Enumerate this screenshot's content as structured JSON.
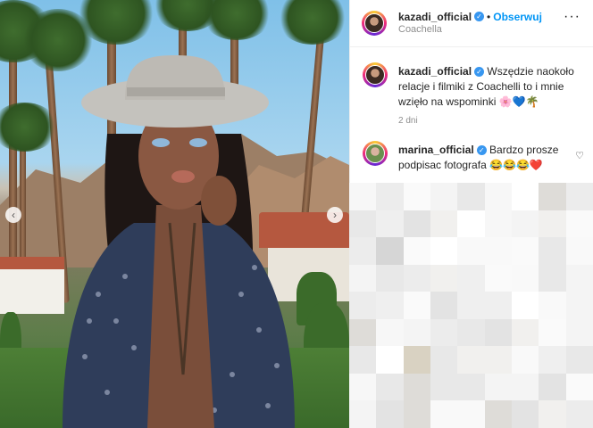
{
  "post": {
    "username": "kazadi_official",
    "follow_label": "Obserwuj",
    "location": "Coachella"
  },
  "comments": [
    {
      "username": "kazadi_official",
      "text": "Wszędzie naokoło relacje i filmiki z Coachelli to i mnie wzięło na wspominki",
      "emojis": "🌸💙🌴",
      "time": "2 dni"
    },
    {
      "username": "marina_official",
      "text": "Bardzo prosze podpisac fotografa",
      "emojis": "😂😂😂❤️"
    }
  ],
  "icons": {
    "verified": "verified-badge-icon",
    "more": "more-options-icon",
    "heart": "heart-icon",
    "prev": "chevron-left-icon",
    "next": "chevron-right-icon"
  },
  "colors": {
    "accent": "#0095f6",
    "verified": "#3897f0",
    "muted": "#8e8e8e"
  }
}
